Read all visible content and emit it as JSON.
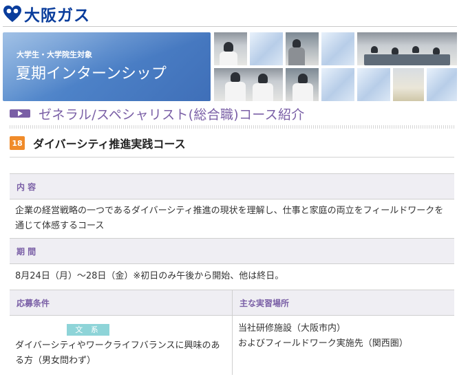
{
  "header": {
    "logo_text": "大阪ガス",
    "logo_color": "#0a3d9c"
  },
  "banner": {
    "subtitle": "大学生・大学院生対象",
    "title": "夏期インターンシップ"
  },
  "section": {
    "icon": "play-icon",
    "title": "ゼネラル/スペシャリスト(総合職)コース紹介",
    "accent": "#7a5fa6"
  },
  "course": {
    "number": "18",
    "number_color": "#f08b2a",
    "title": "ダイバーシティ推進実践コース"
  },
  "table": {
    "content_label": "内 容",
    "content_text": "企業の経営戦略の一つであるダイバーシティ推進の現状を理解し、仕事と家庭の両立をフィールドワークを通じて体感するコース",
    "period_label": "期 間",
    "period_text": "8月24日（月）～28日（金）※初日のみ午後から開始、他は終日。",
    "conditions_label": "応募条件",
    "conditions_tag": "文 系",
    "conditions_text": "ダイバーシティやワークライフバランスに興味のある方（男女問わず）",
    "place_label": "主な実習場所",
    "place_line1": "当社研修施設（大阪市内）",
    "place_line2": "およびフィールドワーク実施先（関西圏）"
  }
}
